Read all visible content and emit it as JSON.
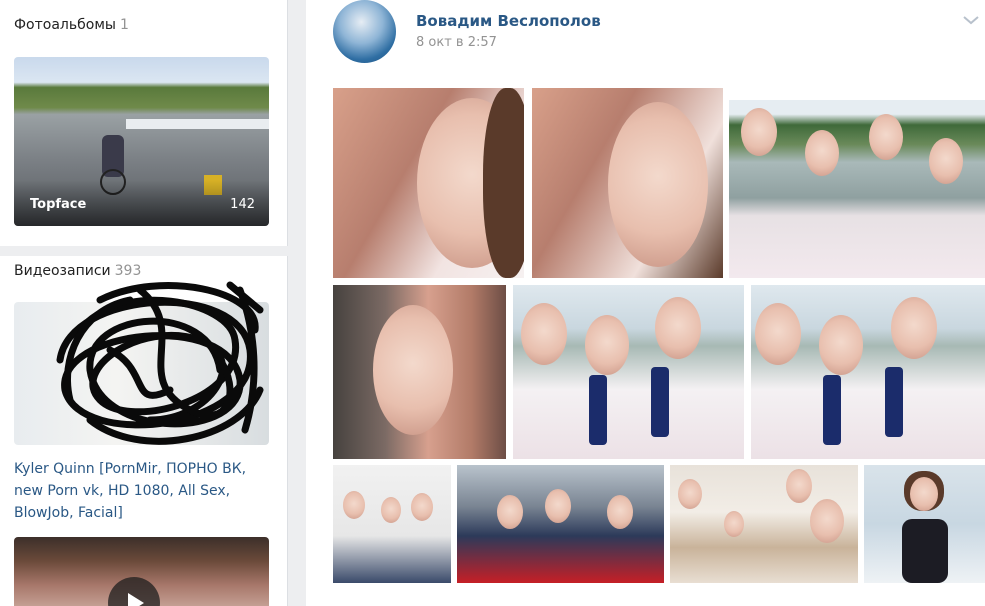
{
  "sidebar": {
    "albums": {
      "title": "Фотоальбомы",
      "count": "1",
      "album": {
        "name": "Topface",
        "photos": "142"
      }
    },
    "videos": {
      "title": "Видеозаписи",
      "count": "393",
      "video_title": "Kyler Quinn [PornMir, ПОРНО ВК, new Porn vk, HD 1080, All Sex, BlowJob, Facial]"
    }
  },
  "post": {
    "author": "Вовадим Веслополов",
    "date": "8 окт в 2:57"
  },
  "colors": {
    "link": "#2a5885",
    "page_bg": "#edeef0",
    "muted": "#939393"
  },
  "icons": {
    "chevron": "chevron-down-icon",
    "play": "play-icon"
  }
}
